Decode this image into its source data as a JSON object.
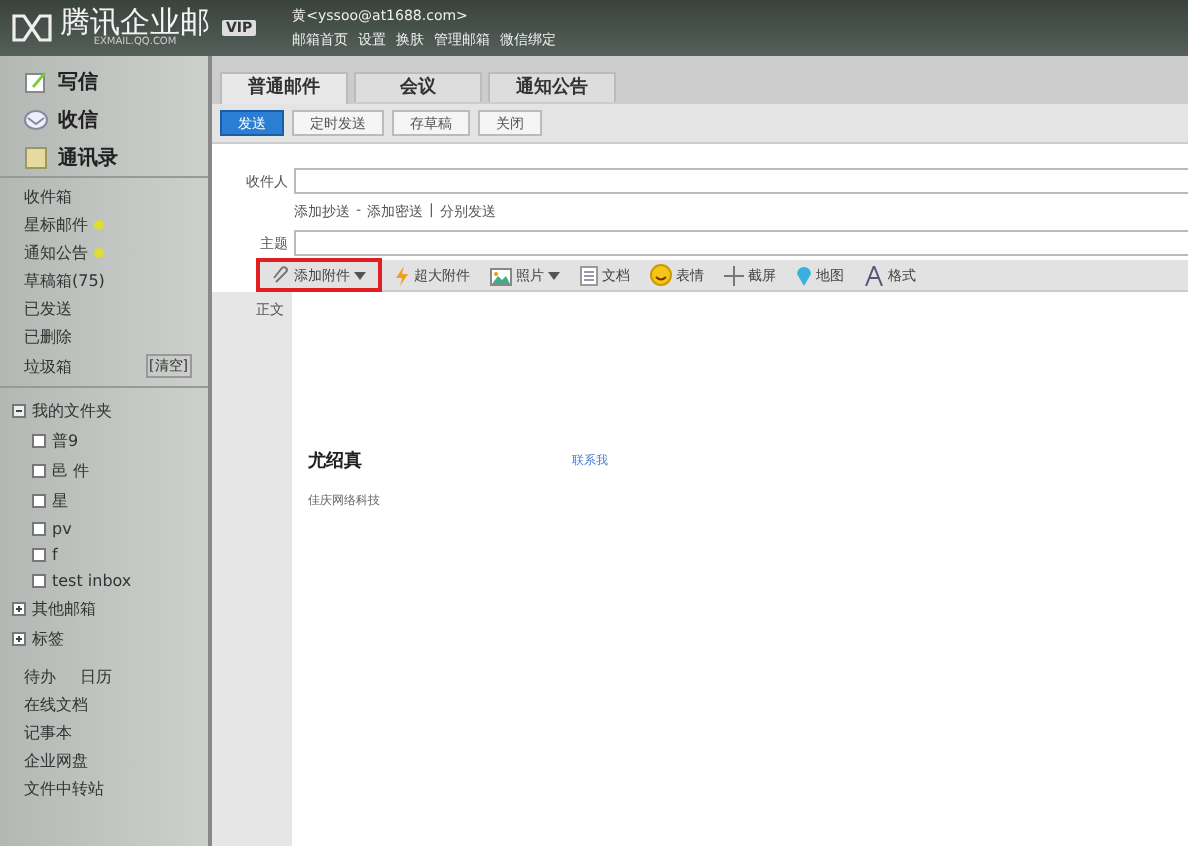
{
  "header": {
    "logo": "腾讯企业邮",
    "logo_sub": "EXMAIL.QQ.COM",
    "badge": "VIP",
    "account": "黄<yssoo@at1688.com>",
    "links": [
      "邮箱首页",
      "设置",
      "换肤",
      "管理邮箱",
      "微信绑定"
    ]
  },
  "sidebar": {
    "actions": [
      {
        "label": "写信",
        "kind": "compose"
      },
      {
        "label": "收信",
        "kind": "inbox"
      },
      {
        "label": "通讯录",
        "kind": "contacts"
      }
    ],
    "folders": [
      {
        "label": "收件箱"
      },
      {
        "label": "星标邮件",
        "flag": true
      },
      {
        "label": "通知公告",
        "flag": true
      },
      {
        "label": "草稿箱(75)"
      },
      {
        "label": "已发送"
      },
      {
        "label": "已删除"
      },
      {
        "label": "垃圾箱",
        "action": "[清空]"
      }
    ],
    "tree": [
      {
        "label": "我的文件夹",
        "expanded": true,
        "children": [
          {
            "label": "普9"
          },
          {
            "label": "邑 件"
          },
          {
            "label": "星"
          },
          {
            "label": "pv"
          },
          {
            "label": "f"
          },
          {
            "label": "test inbox"
          }
        ]
      },
      {
        "label": "其他邮箱",
        "expanded": false
      },
      {
        "label": "标签",
        "expanded": false
      }
    ],
    "tools": [
      [
        "待办",
        "日历"
      ],
      [
        "在线文档"
      ],
      [
        "记事本"
      ],
      [
        "企业网盘"
      ],
      [
        "文件中转站"
      ]
    ]
  },
  "tabs": [
    {
      "label": "普通邮件",
      "selected": true
    },
    {
      "label": "会议",
      "selected": false
    },
    {
      "label": "通知公告",
      "selected": false
    }
  ],
  "buttons": [
    {
      "label": "发送",
      "primary": true
    },
    {
      "label": "定时发送",
      "primary": false
    },
    {
      "label": "存草稿",
      "primary": false
    },
    {
      "label": "关闭",
      "primary": false
    }
  ],
  "form": {
    "to_label": "收件人",
    "cc_links": [
      "添加抄送",
      "添加密送",
      "分别发送"
    ],
    "cc_separators": [
      "-",
      "|"
    ],
    "subject_label": "主题",
    "body_label": "正文"
  },
  "toolbar": [
    {
      "label": "添加附件",
      "kind": "clip",
      "dropdown": true,
      "highlighted": true
    },
    {
      "label": "超大附件",
      "kind": "bolt",
      "dropdown": false,
      "highlighted": false
    },
    {
      "label": "照片",
      "kind": "photo",
      "dropdown": true,
      "highlighted": false
    },
    {
      "label": "文档",
      "kind": "doc",
      "dropdown": false,
      "highlighted": false
    },
    {
      "label": "表情",
      "kind": "smile",
      "dropdown": false,
      "highlighted": false
    },
    {
      "label": "截屏",
      "kind": "crop",
      "dropdown": false,
      "highlighted": false
    },
    {
      "label": "地图",
      "kind": "pin",
      "dropdown": false,
      "highlighted": false
    },
    {
      "label": "格式",
      "kind": "font",
      "dropdown": false,
      "highlighted": false
    }
  ],
  "signature": {
    "name": "尤绍真",
    "link": "联系我",
    "company": "佳庆网络科技"
  }
}
